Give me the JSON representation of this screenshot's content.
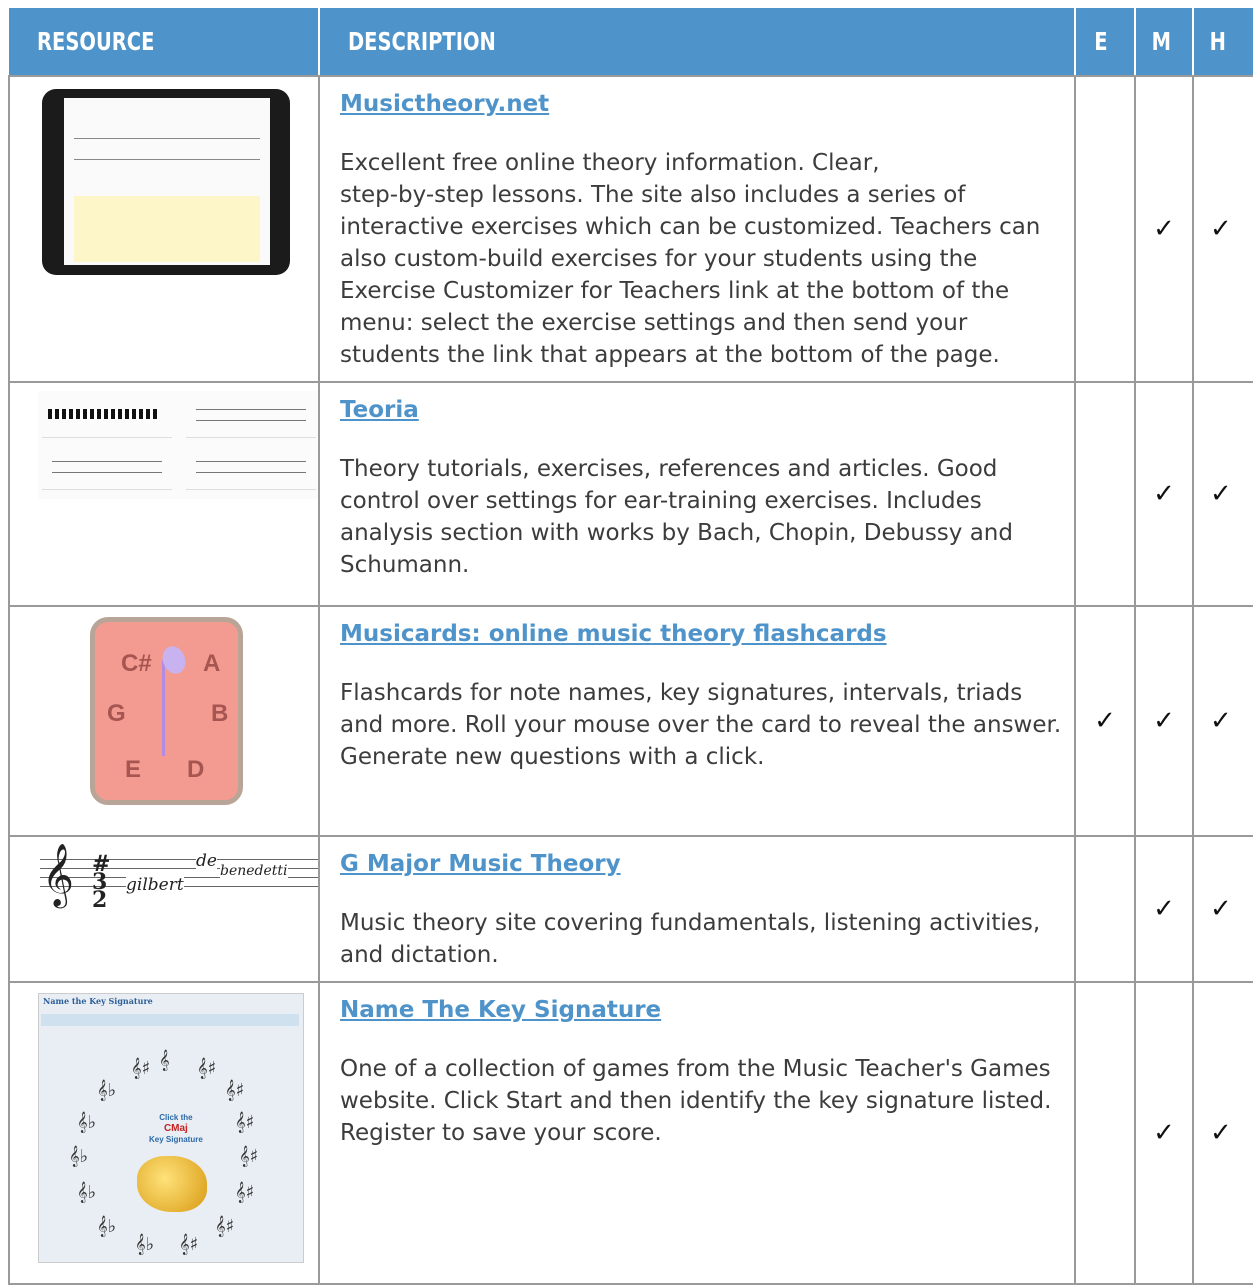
{
  "header": {
    "resource": "RESOURCE",
    "description": "DESCRIPTION",
    "e": "E",
    "m": "M",
    "h": "H"
  },
  "check_glyph": "✓",
  "colors": {
    "header_bg": "#4e93c9",
    "link": "#4e93c9",
    "grid": "#9a9a9a"
  },
  "rows": [
    {
      "title": "Musictheory.net",
      "description": "Excellent free online theory information. Clear,\nstep-by-step lessons. The site also includes a series of interactive exercises which can be customized.  Teachers can also custom-build exercises for your students using the Exercise Customizer for Teachers link at the bottom of the menu: select the exercise settings and then send your students the link that appears at the bottom of the page.",
      "E": false,
      "M": true,
      "H": true
    },
    {
      "title": "Teoria",
      "description": "Theory tutorials, exercises, references and articles. Good control over settings for ear-training exercises. Includes analysis section with works by Bach, Chopin, Debussy and Schumann.",
      "E": false,
      "M": true,
      "H": true
    },
    {
      "title": "Musicards: online music theory flashcards",
      "description": "Flashcards for note names, key signatures, intervals, triads and more. Roll your mouse over the card to reveal the answer. Generate new questions with a click.",
      "E": true,
      "M": true,
      "H": true,
      "thumb": {
        "notes": [
          "C#",
          "A",
          "G",
          "B",
          "E",
          "D"
        ]
      }
    },
    {
      "title": "G Major Music Theory",
      "description": "Music theory site covering fundamentals, listening activities, and dictation.",
      "E": false,
      "M": true,
      "H": true,
      "thumb": {
        "hand1": "gilbert",
        "hand2": "de",
        "hand3": "benedetti"
      }
    },
    {
      "title": "Name The Key Signature",
      "description": "One of a collection of games from the Music Teacher's Games website. Click Start and then identify the key signature listed.  Register to save your score.",
      "E": false,
      "M": true,
      "H": true,
      "thumb": {
        "top": "Name the Key Signature",
        "l1": "Click the",
        "l2": "CMaj",
        "l3": "Key Signature"
      }
    }
  ]
}
